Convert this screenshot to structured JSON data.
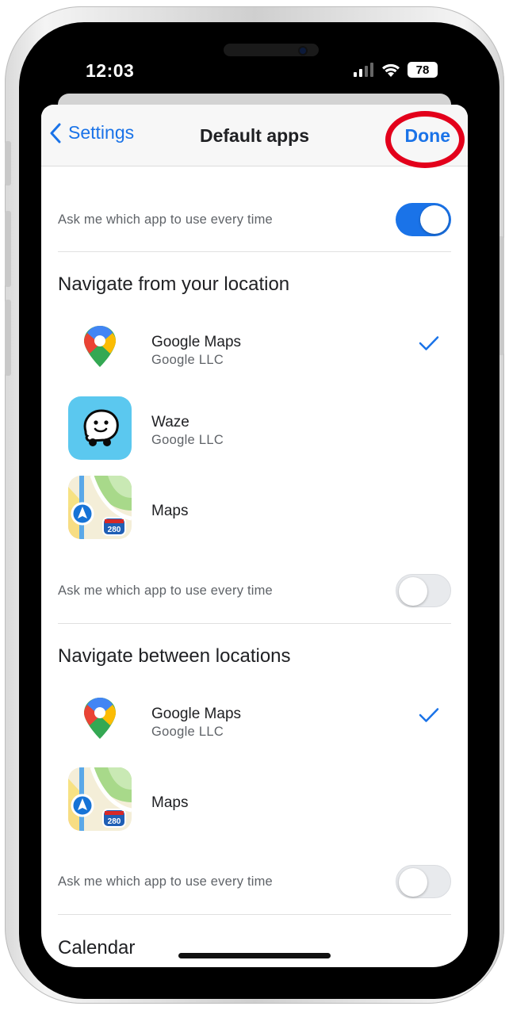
{
  "status": {
    "time": "12:03",
    "battery": "78"
  },
  "nav": {
    "back_label": "Settings",
    "title": "Default apps",
    "done_label": "Done"
  },
  "top_ask": {
    "label": "Ask me which app to use every time",
    "on": true
  },
  "sections": [
    {
      "title": "Navigate from your location",
      "apps": [
        {
          "name": "Google Maps",
          "developer": "Google LLC",
          "icon": "google-maps-icon",
          "selected": true
        },
        {
          "name": "Waze",
          "developer": "Google LLC",
          "icon": "waze-icon",
          "selected": false
        },
        {
          "name": "Maps",
          "developer": "",
          "icon": "apple-maps-icon",
          "selected": false
        }
      ],
      "ask": {
        "label": "Ask me which app to use every time",
        "on": false
      }
    },
    {
      "title": "Navigate between locations",
      "apps": [
        {
          "name": "Google Maps",
          "developer": "Google LLC",
          "icon": "google-maps-icon",
          "selected": true
        },
        {
          "name": "Maps",
          "developer": "",
          "icon": "apple-maps-icon",
          "selected": false
        }
      ],
      "ask": {
        "label": "Ask me which app to use every time",
        "on": false
      }
    },
    {
      "title": "Calendar"
    }
  ],
  "map_badge": "280",
  "colors": {
    "accent": "#1a73e8",
    "highlight": "#e3001b"
  }
}
